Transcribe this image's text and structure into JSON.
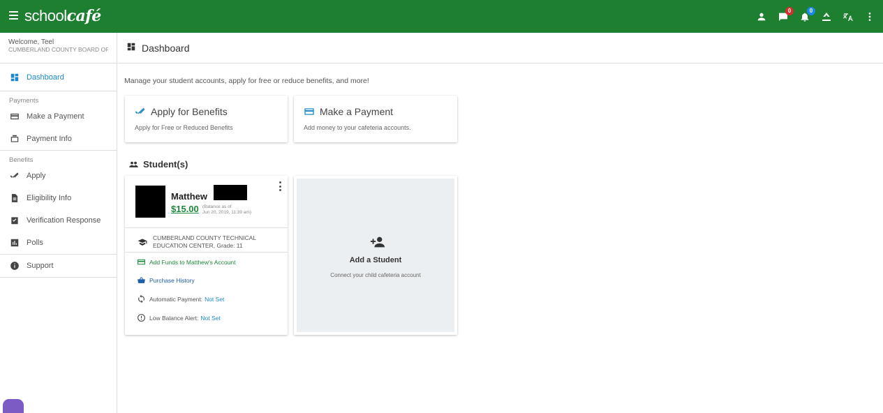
{
  "app": {
    "logo_main": "school",
    "logo_accent": "café",
    "brand_color": "#1d7f2f",
    "badge_messages": "0",
    "badge_notifications": "0"
  },
  "sidebar": {
    "welcome": "Welcome, Teel",
    "district": "CUMBERLAND COUNTY BOARD OF EDUCATION",
    "dashboard_label": "Dashboard",
    "payments_section": "Payments",
    "make_payment_label": "Make a Payment",
    "payment_info_label": "Payment Info",
    "benefits_section": "Benefits",
    "apply_label": "Apply",
    "eligibility_label": "Eligibility Info",
    "verification_label": "Verification Response",
    "polls_label": "Polls",
    "support_label": "Support"
  },
  "header": {
    "title": "Dashboard"
  },
  "main": {
    "intro": "Manage your student accounts, apply for free or reduce benefits, and more!",
    "benefits_card": {
      "title": "Apply for Benefits",
      "desc": "Apply for Free or Reduced Benefits"
    },
    "payment_card": {
      "title": "Make a Payment",
      "desc": "Add money to your cafeteria accounts."
    },
    "students_heading": "Student(s)"
  },
  "student": {
    "name": "Matthew",
    "balance": "$15.00",
    "balance_note_1": "(Balance as of",
    "balance_note_2": "Jun 20, 2019, 11:39 am)",
    "school_line1": "CUMBERLAND COUNTY TECHNICAL",
    "school_line2": "EDUCATION CENTER, Grade: 11",
    "add_funds": "Add Funds to Matthew's Account",
    "purchase_history": "Purchase History",
    "auto_payment_label": "Automatic Payment:",
    "auto_payment_value": "Not Set",
    "low_balance_label": "Low Balance Alert:",
    "low_balance_value": "Not Set"
  },
  "add_student": {
    "title": "Add a Student",
    "desc": "Connect your child cafeteria account"
  }
}
